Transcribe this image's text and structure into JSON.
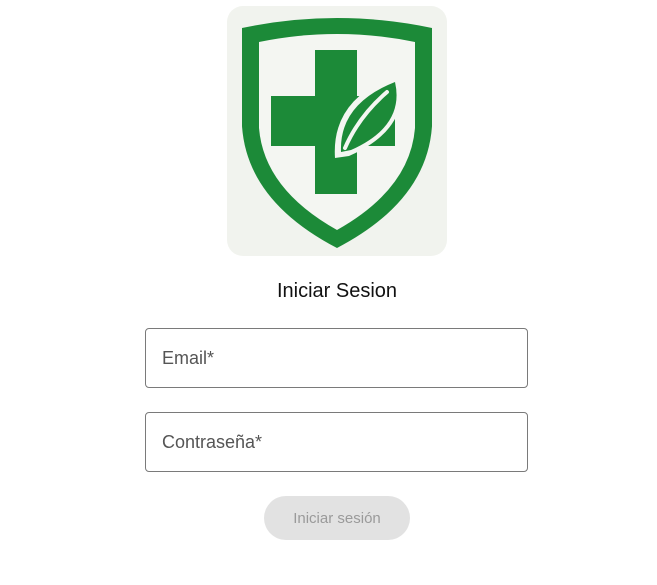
{
  "logo": {
    "icon": "shield-cross-leaf-icon",
    "brand_color": "#1c8a38"
  },
  "form": {
    "title": "Iniciar Sesion",
    "email_placeholder": "Email*",
    "password_placeholder": "Contraseña*",
    "submit_label": "Iniciar sesión"
  },
  "colors": {
    "button_disabled_bg": "#e2e2e2",
    "button_disabled_text": "#9a9a9a",
    "field_border": "#7a7a7a"
  }
}
